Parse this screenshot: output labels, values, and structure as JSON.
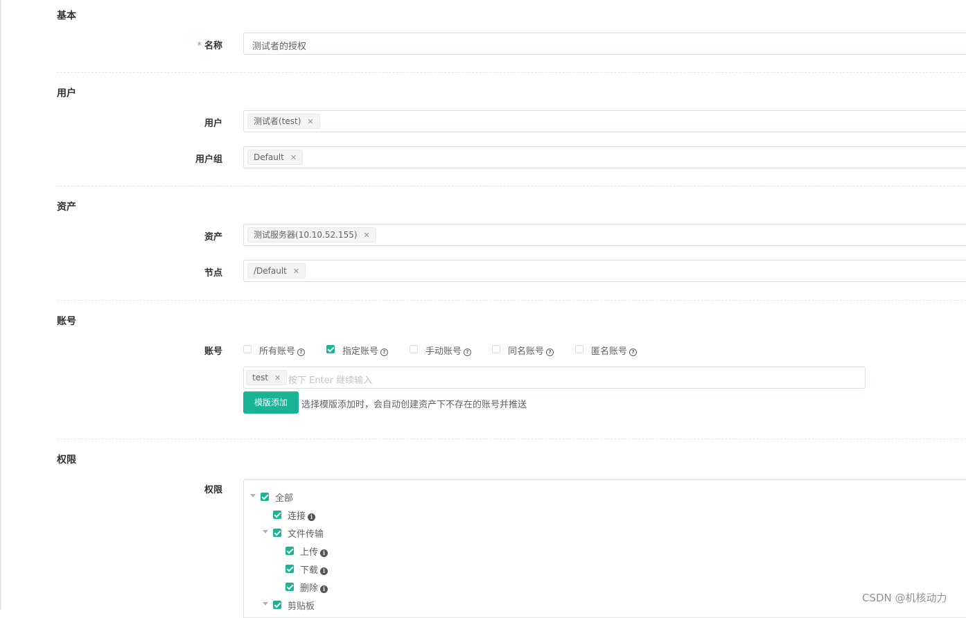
{
  "sections": {
    "basic": "基本",
    "user": "用户",
    "asset": "资产",
    "account": "账号",
    "permission": "权限"
  },
  "basic": {
    "name_required_mark": "*",
    "name_label": "名称",
    "name_value": "测试者的授权"
  },
  "user": {
    "users_label": "用户",
    "users_tag": "测试者(test)",
    "groups_label": "用户组",
    "groups_tag": "Default"
  },
  "asset": {
    "assets_label": "资产",
    "assets_tag": "测试服务器(10.10.52.155)",
    "nodes_label": "节点",
    "nodes_tag": "/Default"
  },
  "account": {
    "label": "账号",
    "options": [
      {
        "label": "所有账号",
        "checked": false
      },
      {
        "label": "指定账号",
        "checked": true
      },
      {
        "label": "手动账号",
        "checked": false
      },
      {
        "label": "同名账号",
        "checked": false
      },
      {
        "label": "匿名账号",
        "checked": false
      }
    ],
    "input_tag": "test",
    "input_placeholder": "按下 Enter 继续输入",
    "template_button": "模版添加",
    "template_hint": "选择模版添加时，会自动创建资产下不存在的账号并推送"
  },
  "permission": {
    "label": "权限",
    "tree": [
      {
        "label": "全部",
        "checked": true
      },
      {
        "label": "连接",
        "checked": true
      },
      {
        "label": "文件传输",
        "checked": true
      },
      {
        "label": "上传",
        "checked": true
      },
      {
        "label": "下载",
        "checked": true
      },
      {
        "label": "删除",
        "checked": true
      },
      {
        "label": "剪贴板",
        "checked": true
      }
    ]
  },
  "icons": {
    "tag_close": "close-icon",
    "help": "question-circle-icon",
    "info": "info-circle-icon",
    "expand": "caret-down-icon"
  },
  "colors": {
    "primary": "#1ab394",
    "required": "#f56c6c"
  },
  "watermark": "CSDN @机核动力"
}
